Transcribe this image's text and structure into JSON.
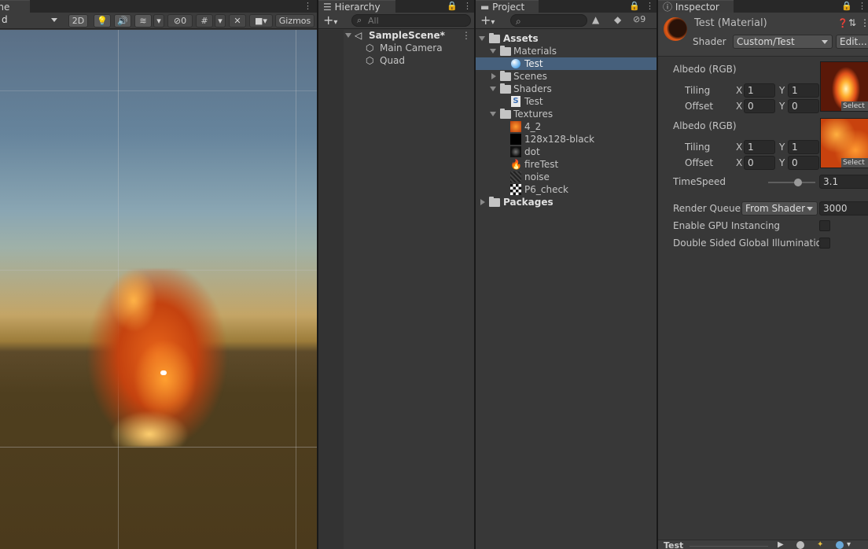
{
  "scene": {
    "tab_label": "ene",
    "draw_mode": "d",
    "btn_2d": "2D",
    "hidden_count": "0",
    "gizmos": "Gizmos"
  },
  "hierarchy": {
    "tab_label": "Hierarchy",
    "search_placeholder": "All",
    "scene_name": "SampleScene*",
    "items": [
      "Main Camera",
      "Quad"
    ]
  },
  "project": {
    "tab_label": "Project",
    "hidden_count": "9",
    "tree": {
      "assets": "Assets",
      "materials": "Materials",
      "material_test": "Test",
      "scenes": "Scenes",
      "shaders": "Shaders",
      "shader_test": "Test",
      "textures": "Textures",
      "texture_items": [
        "4_2",
        "128x128-black",
        "dot",
        "fireTest",
        "noise",
        "P6_check"
      ],
      "packages": "Packages"
    }
  },
  "inspector": {
    "tab_label": "Inspector",
    "title": "Test (Material)",
    "shader_label": "Shader",
    "shader_value": "Custom/Test",
    "edit_button": "Edit...",
    "albedo1": {
      "label": "Albedo (RGB)",
      "tiling_label": "Tiling",
      "offset_label": "Offset",
      "tiling_x": "1",
      "tiling_y": "1",
      "offset_x": "0",
      "offset_y": "0",
      "select": "Select"
    },
    "albedo2": {
      "label": "Albedo (RGB)",
      "tiling_label": "Tiling",
      "offset_label": "Offset",
      "tiling_x": "1",
      "tiling_y": "1",
      "offset_x": "0",
      "offset_y": "0",
      "select": "Select"
    },
    "axis_x": "X",
    "axis_y": "Y",
    "timespeed_label": "TimeSpeed",
    "timespeed_value": "3.1",
    "render_queue_label": "Render Queue",
    "render_queue_mode": "From Shader",
    "render_queue_value": "3000",
    "gpu_instancing_label": "Enable GPU Instancing",
    "double_sided_label": "Double Sided Global Illumination",
    "preview_title": "Test"
  },
  "colors": {
    "accent_selection": "#46607c",
    "fire": "#e8651a"
  }
}
